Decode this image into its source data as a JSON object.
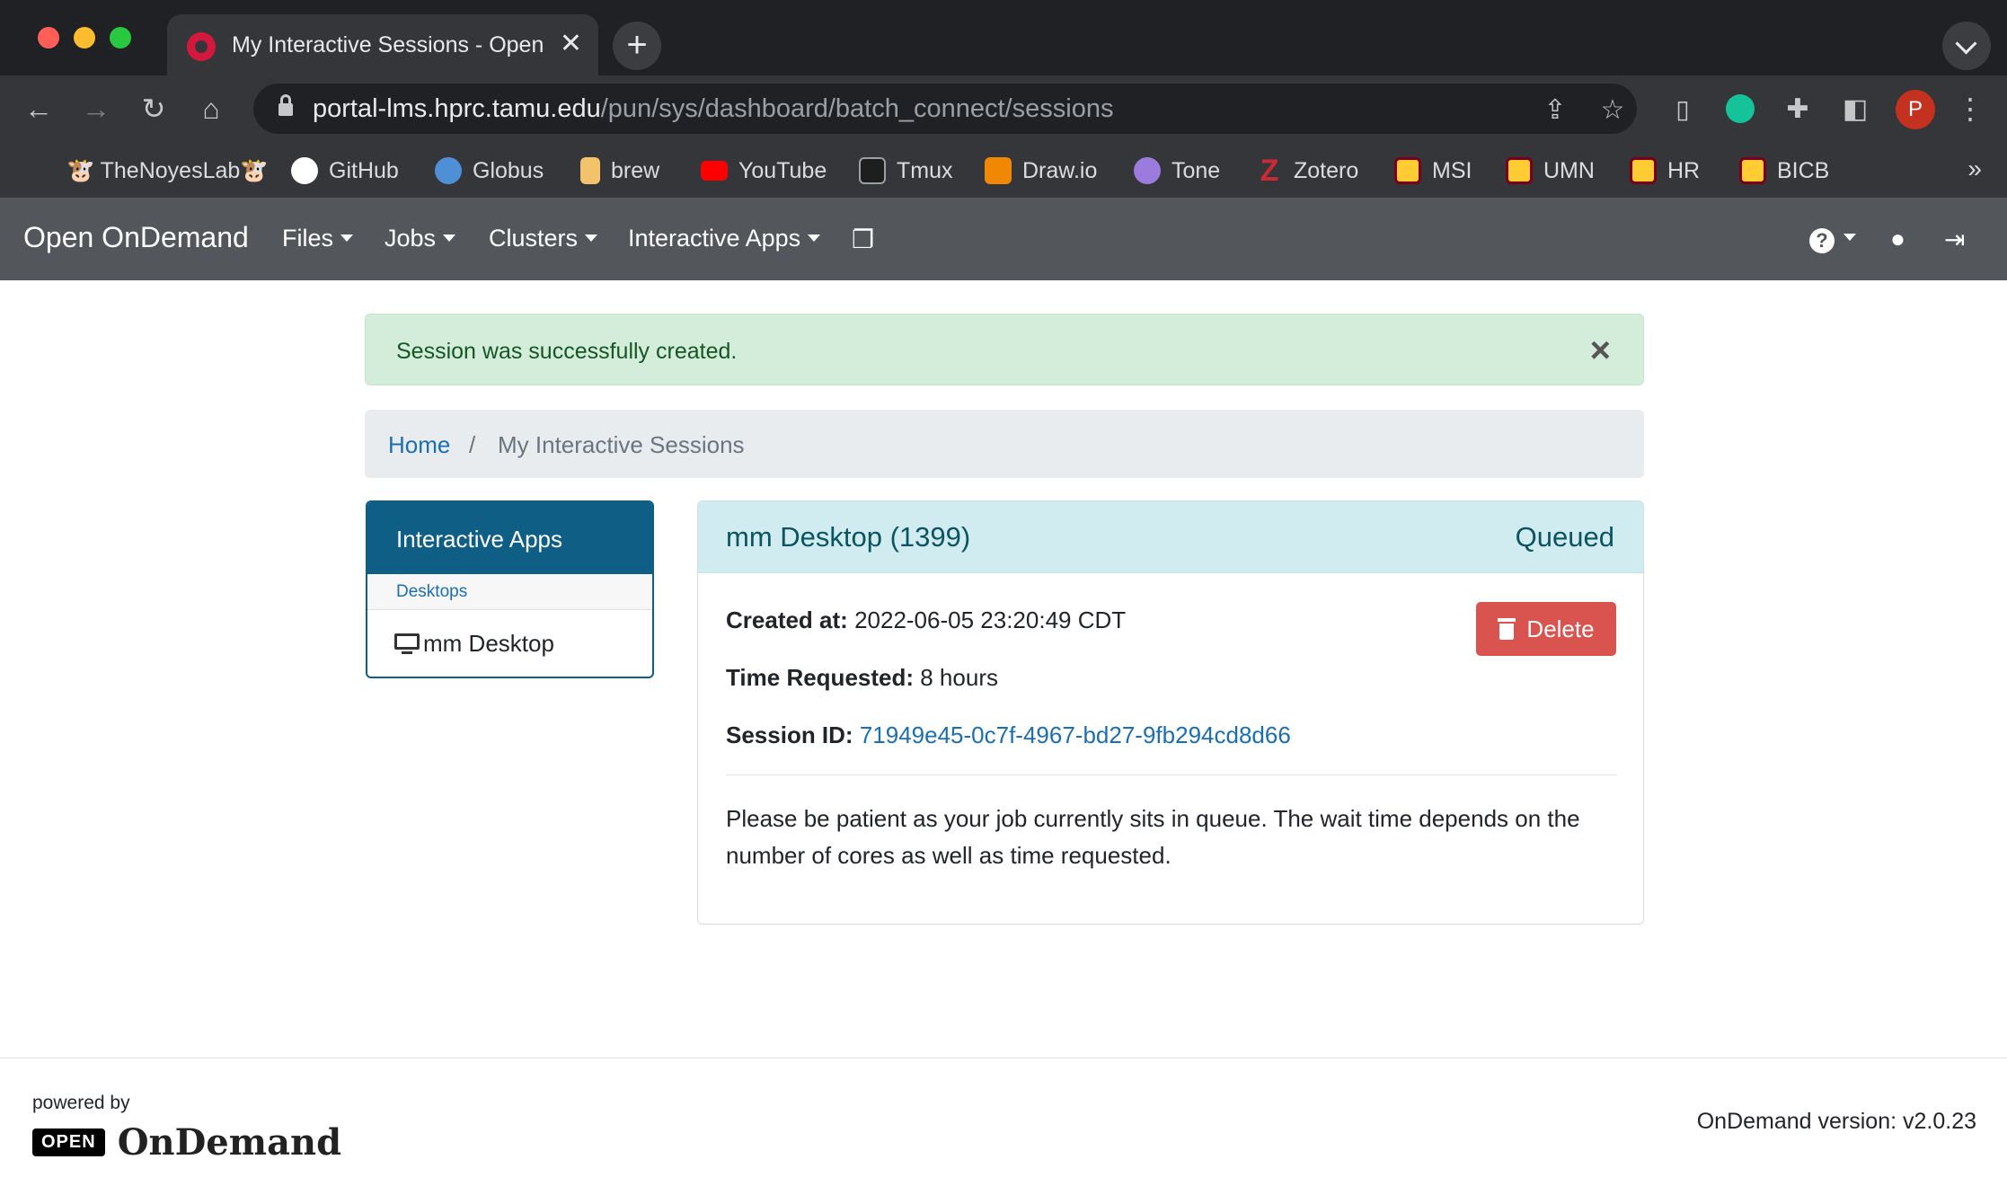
{
  "browser": {
    "tab_title": "My Interactive Sessions - Open OnDemand",
    "tab_close": "✕",
    "new_tab": "+",
    "url_host": "portal-lms.hprc.tamu.edu",
    "url_path": "/pun/sys/dashboard/batch_connect/sessions",
    "profile_initial": "P",
    "bookmarks": [
      {
        "label": "🐮 TheNoyesLab🐮",
        "color": "#35363a"
      },
      {
        "label": "GitHub",
        "color": "#ffffff"
      },
      {
        "label": "Globus",
        "color": "#4f8fd6"
      },
      {
        "label": "brew",
        "color": "#f2c36b"
      },
      {
        "label": "YouTube",
        "color": "#ff0000"
      },
      {
        "label": "Tmux",
        "color": "#1e1e1e"
      },
      {
        "label": "Draw.io",
        "color": "#f08705"
      },
      {
        "label": "Tone",
        "color": "#9b7bdb"
      },
      {
        "label": "Zotero",
        "color": "#cc2936"
      },
      {
        "label": "MSI",
        "color": "#ffcc33"
      },
      {
        "label": "UMN",
        "color": "#ffcc33"
      },
      {
        "label": "HR",
        "color": "#ffcc33"
      },
      {
        "label": "BICB",
        "color": "#ffcc33"
      }
    ],
    "bookmarks_more": "»"
  },
  "navbar": {
    "brand": "Open OnDemand",
    "items": [
      "Files",
      "Jobs",
      "Clusters",
      "Interactive Apps"
    ]
  },
  "alert": {
    "text": "Session was successfully created.",
    "close": "×"
  },
  "breadcrumb": {
    "home": "Home",
    "separator": "/",
    "current": "My Interactive Sessions"
  },
  "sidebar": {
    "header": "Interactive Apps",
    "category": "Desktops",
    "item": "mm Desktop"
  },
  "session": {
    "title": "mm Desktop (1399)",
    "status": "Queued",
    "created_label": "Created at:",
    "created_value": "2022-06-05 23:20:49 CDT",
    "time_label": "Time Requested:",
    "time_value": "8 hours",
    "id_label": "Session ID:",
    "id_value": "71949e45-0c7f-4967-bd27-9fb294cd8d66",
    "delete_label": "Delete",
    "message": "Please be patient as your job currently sits in queue. The wait time depends on the number of cores as well as time requested."
  },
  "footer": {
    "powered_by": "powered by",
    "logo_open": "OPEN",
    "logo_word": "OnDemand",
    "version": "OnDemand version: v2.0.23"
  },
  "colors": {
    "navbar": "#53565a",
    "sidebar_header": "#0e5e86",
    "alert_bg": "#d4edda",
    "card_head": "#d1ecf1",
    "danger": "#d9534f",
    "link": "#1a6fb3"
  }
}
